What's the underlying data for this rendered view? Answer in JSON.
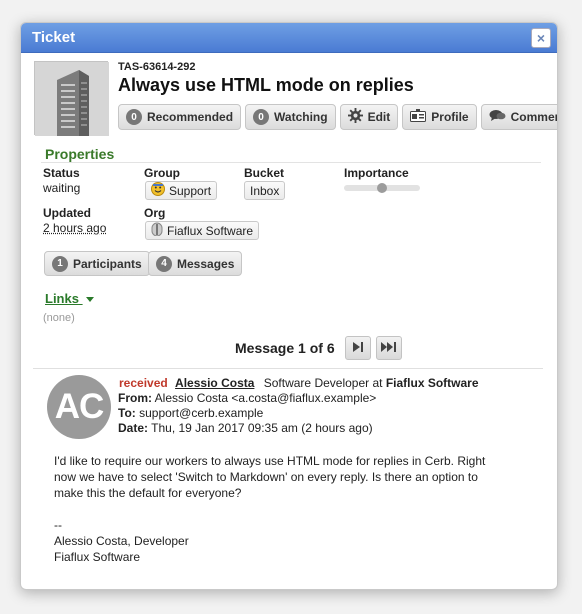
{
  "dialog": {
    "title": "Ticket",
    "close_icon": "×"
  },
  "ticket": {
    "mask": "TAS-63614-292",
    "subject": "Always use HTML mode on replies"
  },
  "toolbar": {
    "recommended": {
      "count": "0",
      "label": "Recommended"
    },
    "watching": {
      "count": "0",
      "label": "Watching"
    },
    "edit": {
      "label": "Edit"
    },
    "profile": {
      "label": "Profile"
    },
    "comment": {
      "label": "Comment"
    }
  },
  "properties": {
    "title": "Properties",
    "status": {
      "label": "Status",
      "value": "waiting"
    },
    "group": {
      "label": "Group",
      "value": "Support"
    },
    "bucket": {
      "label": "Bucket",
      "value": "Inbox"
    },
    "importance": {
      "label": "Importance",
      "level": 0.5
    },
    "updated": {
      "label": "Updated",
      "value": "2 hours ago"
    },
    "org": {
      "label": "Org",
      "value": "Fiaflux Software"
    }
  },
  "tabs": {
    "participants": {
      "count": "1",
      "label": "Participants"
    },
    "messages": {
      "count": "4",
      "label": "Messages"
    }
  },
  "links": {
    "title": "Links",
    "value": "(none)"
  },
  "message_nav": {
    "counter": "Message 1 of 6"
  },
  "message": {
    "avatar_initials": "AC",
    "status": "received",
    "sender_name": "Alessio Costa",
    "sender_title": "Software Developer at",
    "sender_org": "Fiaflux Software",
    "from_label": "From:",
    "from_value": "Alessio Costa <a.costa@fiaflux.example>",
    "to_label": "To:",
    "to_value": "support@cerb.example",
    "date_label": "Date:",
    "date_value": "Thu, 19 Jan 2017 09:35 am (2 hours ago)",
    "body": [
      "I'd like to require our workers to always use HTML mode for replies in Cerb. Right",
      "now we have to select 'Switch to Markdown' on every reply. Is there an option to",
      "make this the default for everyone?",
      "",
      "--",
      "Alessio Costa, Developer",
      "Fiaflux Software"
    ]
  },
  "colors": {
    "titlebar": "#4a7bd3",
    "section_green": "#3a7a2a",
    "received_red": "#c0392b"
  }
}
